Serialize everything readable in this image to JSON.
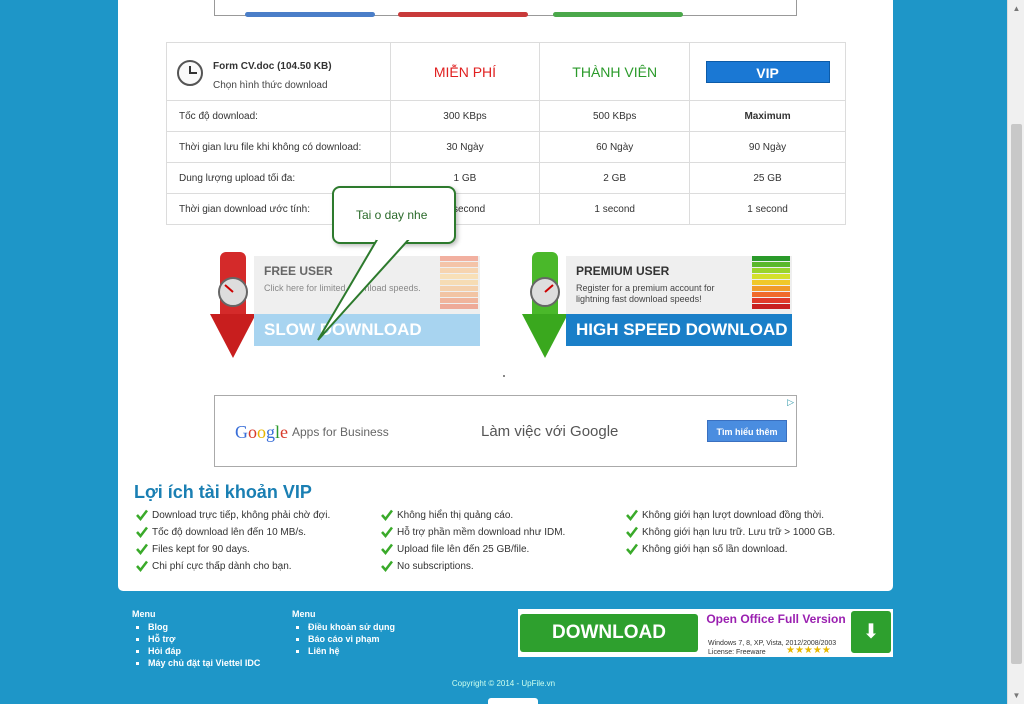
{
  "file": {
    "name": "Form CV.doc (104.50 KB)",
    "subtitle": "Chọn hình thức download"
  },
  "plans": {
    "free": "MIỄN PHÍ",
    "member": "THÀNH VIÊN",
    "vip": "VIP"
  },
  "rows": [
    {
      "label": "Tốc độ download:",
      "free": "300 KBps",
      "member": "500 KBps",
      "vip": "Maximum"
    },
    {
      "label": "Thời gian lưu file khi không có download:",
      "free": "30 Ngày",
      "member": "60 Ngày",
      "vip": "90 Ngày"
    },
    {
      "label": "Dung lượng upload tối đa:",
      "free": "1 GB",
      "member": "2 GB",
      "vip": "25 GB"
    },
    {
      "label": "Thời gian download ước tính:",
      "free": "1 second",
      "member": "1 second",
      "vip": "1 second"
    }
  ],
  "bubble": "Tai o day nhe",
  "free_box": {
    "title": "FREE USER",
    "desc": "Click here for limited download speeds.",
    "button": "SLOW DOWNLOAD"
  },
  "premium_box": {
    "title": "PREMIUM USER",
    "desc": "Register for a premium account for lightning fast download speeds!",
    "button": "HIGH SPEED DOWNLOAD"
  },
  "google_ad": {
    "logo": "Google",
    "apps": "Apps for Business",
    "tagline": "Làm việc với Google",
    "button": "Tìm hiểu thêm"
  },
  "vip_benefits": {
    "title": "Lợi ích tài khoản VIP",
    "col1": [
      "Download trực tiếp, không phải chờ đợi.",
      "Tốc độ download lên đến 10 MB/s.",
      "Files kept for 90 days.",
      "Chi phí cực thấp dành cho bạn."
    ],
    "col2": [
      "Không hiển thị quảng cáo.",
      "Hỗ trợ phần mềm download như IDM.",
      "Upload file lên đến 25 GB/file.",
      "No subscriptions."
    ],
    "col3": [
      "Không giới hạn lượt download đồng thời.",
      "Không giới hạn lưu trữ. Lưu trữ > 1000 GB.",
      "Không giới hạn số lần download."
    ]
  },
  "footer": {
    "menu1_title": "Menu",
    "menu1": [
      "Blog",
      "Hỗ trợ",
      "Hỏi đáp",
      "Máy chủ đặt tại Viettel IDC"
    ],
    "menu2_title": "Menu",
    "menu2": [
      "Điều khoản sử dụng",
      "Báo cáo vi phạm",
      "Liên hệ"
    ],
    "copyright": "Copyright © 2014 - UpFile.vn"
  },
  "oo_ad": {
    "button": "DOWNLOAD",
    "title": "Open Office Full Version",
    "os": "Windows 7, 8, XP, Vista, 2012/2008/2003",
    "license": "License: Freeware",
    "stars": "★★★★★"
  },
  "colors": {
    "background": "#1e96c8",
    "free_red": "#e02020",
    "member_green": "#2a9a2a",
    "vip_blue": "#1a78d4",
    "title_blue": "#1a7fb3"
  }
}
